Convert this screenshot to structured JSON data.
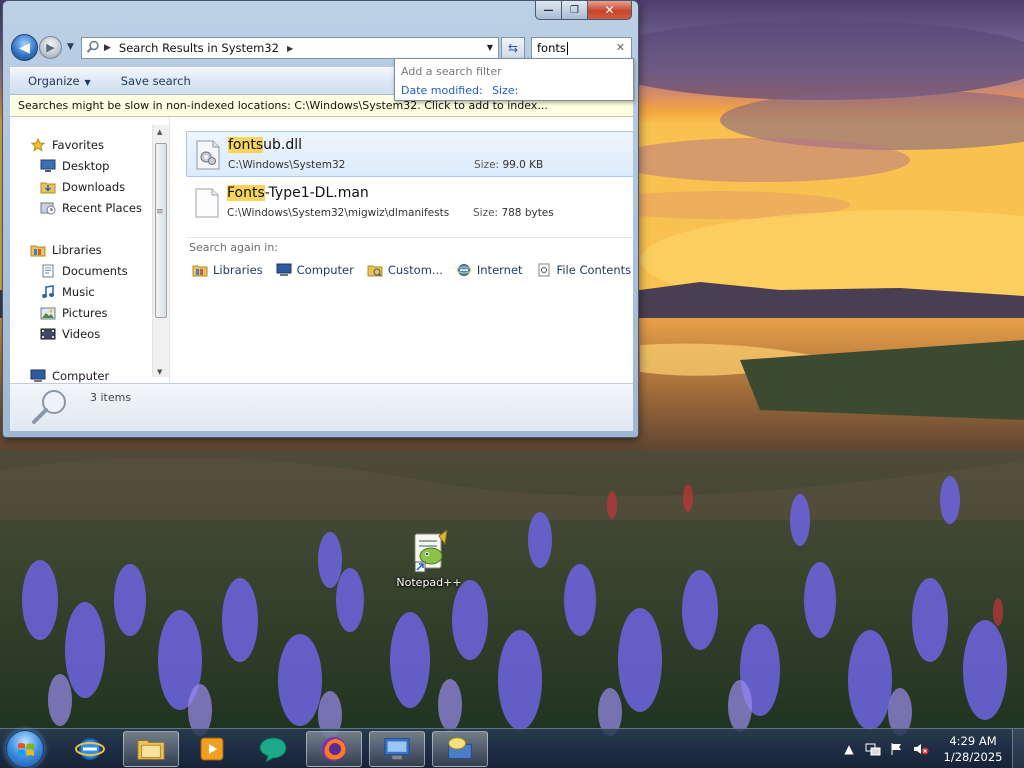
{
  "explorer": {
    "caption": {
      "minimize": "—",
      "maximize": "❐",
      "close": "✕"
    },
    "address": {
      "location": "Search Results in System32"
    },
    "search": {
      "query": "fonts"
    },
    "filter_popup": {
      "title": "Add a search filter",
      "options": [
        "Date modified:",
        "Size:"
      ]
    },
    "commands": {
      "organize": "Organize",
      "save_search": "Save search"
    },
    "info_bar": "Searches might be slow in non-indexed locations: C:\\Windows\\System32. Click to add to index...",
    "nav_pane": {
      "favorites": "Favorites",
      "desktop": "Desktop",
      "downloads": "Downloads",
      "recent_places": "Recent Places",
      "libraries": "Libraries",
      "documents": "Documents",
      "music": "Music",
      "pictures": "Pictures",
      "videos": "Videos",
      "computer": "Computer"
    },
    "results": [
      {
        "name_match": "fonts",
        "name_rest": "ub.dll",
        "path": "C:\\Windows\\System32",
        "size_label": "Size:",
        "size": "99.0 KB",
        "icon": "dll-file-icon"
      },
      {
        "name_match": "Fonts",
        "name_rest": "-Type1-DL.man",
        "path": "C:\\Windows\\System32\\migwiz\\dlmanifests",
        "size_label": "Size:",
        "size": "788 bytes",
        "icon": "generic-file-icon"
      }
    ],
    "search_again": {
      "label": "Search again in:",
      "locations": [
        "Libraries",
        "Computer",
        "Custom...",
        "Internet",
        "File Contents"
      ]
    },
    "details": {
      "count": "3 items"
    }
  },
  "desktop": {
    "icons": [
      {
        "label": "Notepad++",
        "icon": "notepad-plus-plus-icon"
      }
    ]
  },
  "taskbar": {
    "pinned": [
      "internet-explorer-icon",
      "windows-explorer-icon",
      "media-player-icon",
      "chat-icon",
      "firefox-icon",
      "remote-desktop-icon",
      "network-chat-icon"
    ],
    "clock": {
      "time": "4:29 AM",
      "date": "1/28/2025"
    }
  },
  "colors": {
    "highlight": "#f7d55d",
    "link": "#1d5ec5",
    "info_bar": "#ffffe1"
  }
}
